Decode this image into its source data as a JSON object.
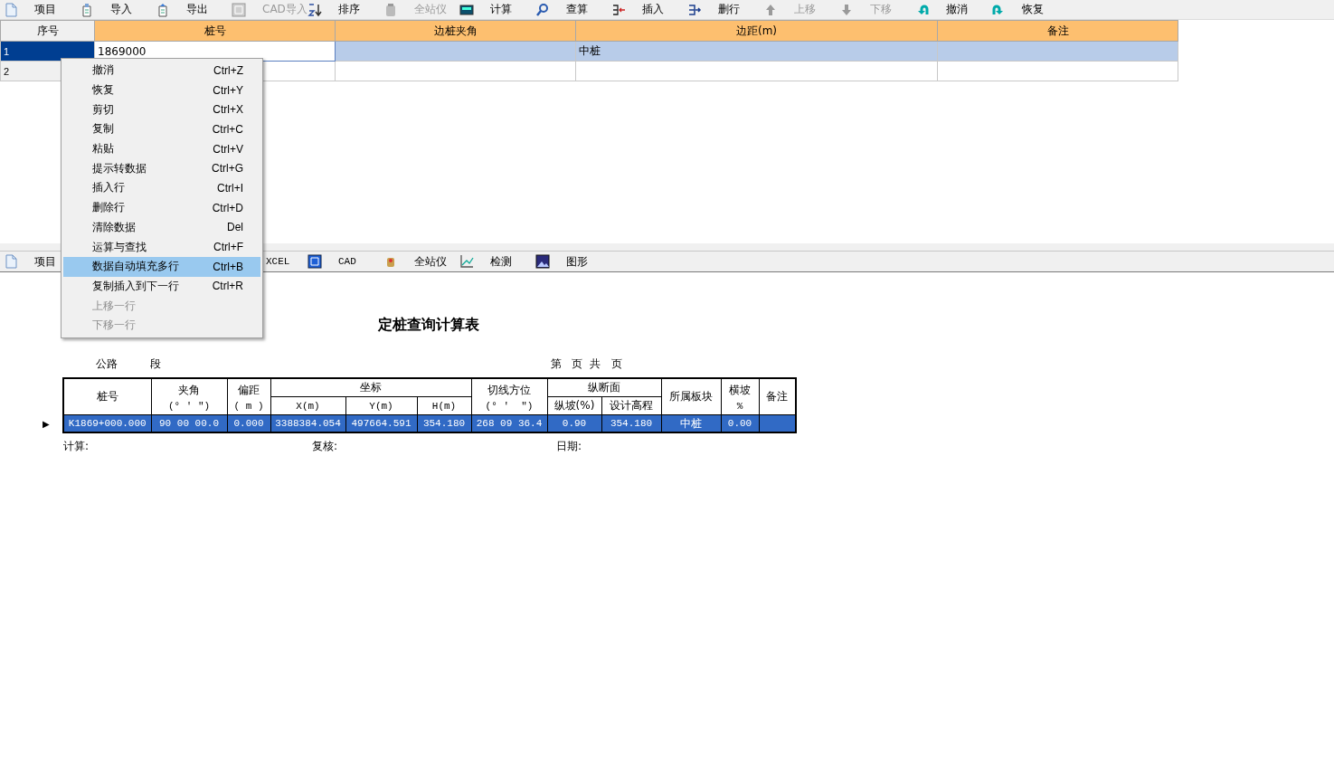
{
  "toolbar": {
    "items": [
      {
        "label": "项目",
        "disabled": false
      },
      {
        "label": "导入",
        "disabled": false
      },
      {
        "label": "导出",
        "disabled": false
      },
      {
        "label": "CAD导入",
        "disabled": true
      },
      {
        "label": "排序",
        "disabled": false
      },
      {
        "label": "全站仪",
        "disabled": true
      },
      {
        "label": "计算",
        "disabled": false
      },
      {
        "label": "查算",
        "disabled": false
      },
      {
        "label": "插入",
        "disabled": false
      },
      {
        "label": "删行",
        "disabled": false
      },
      {
        "label": "上移",
        "disabled": true
      },
      {
        "label": "下移",
        "disabled": true
      },
      {
        "label": "撤消",
        "disabled": false
      },
      {
        "label": "恢复",
        "disabled": false
      }
    ]
  },
  "grid": {
    "columns": [
      "序号",
      "桩号",
      "边桩夹角",
      "边距(m)",
      "备注"
    ],
    "rows": [
      {
        "selected": true,
        "cells": [
          "1",
          "1869000",
          "",
          "中桩",
          ""
        ]
      },
      {
        "selected": false,
        "cells": [
          "2",
          "",
          "",
          "",
          ""
        ]
      }
    ]
  },
  "report_toolbar": {
    "items": [
      {
        "label": "项目"
      },
      {
        "label": "XCEL"
      },
      {
        "label": "CAD"
      },
      {
        "label": "全站仪"
      },
      {
        "label": "检测"
      },
      {
        "label": "图形"
      }
    ]
  },
  "report": {
    "title": "定桩查询计算表",
    "road_label": "公路",
    "section_label": "段",
    "page_label": "第   页  共   页",
    "columns": [
      {
        "label": "桩号",
        "grouped": false
      },
      {
        "label": "夹角",
        "unit": "(° ′ ″)",
        "grouped": false
      },
      {
        "label": "偏距",
        "unit": "( m )",
        "grouped": false
      },
      {
        "label": "X(m)",
        "grouped": true
      },
      {
        "label": "Y(m)",
        "grouped": true
      },
      {
        "label": "H(m)",
        "grouped": true
      },
      {
        "label": "切线方位",
        "unit": "(° ′  ″)",
        "grouped": false
      },
      {
        "label": "纵坡(%)",
        "grouped": true
      },
      {
        "label": "设计高程",
        "grouped": true
      },
      {
        "label": "所属板块",
        "grouped": false
      },
      {
        "label": "横坡",
        "unit": "%",
        "grouped": false
      },
      {
        "label": "备注",
        "grouped": false
      }
    ],
    "column_groups": [
      "坐标",
      "纵断面"
    ],
    "rows": [
      {
        "selected": true,
        "marker": "▶",
        "cells": [
          "K1869+000.000",
          "90 00 00.0",
          "0.000",
          "3388384.054",
          "497664.591",
          "354.180",
          "268 09 36.4",
          "0.90",
          "354.180",
          "中桩",
          "0.00",
          ""
        ]
      }
    ],
    "footer": [
      "计算:",
      "复核:",
      "日期:"
    ]
  },
  "context_menu": {
    "items": [
      {
        "label": "撤消",
        "shortcut": "Ctrl+Z",
        "disabled": false,
        "selected": false
      },
      {
        "label": "恢复",
        "shortcut": "Ctrl+Y",
        "disabled": false,
        "selected": false
      },
      {
        "label": "剪切",
        "shortcut": "Ctrl+X",
        "disabled": false,
        "selected": false
      },
      {
        "label": "复制",
        "shortcut": "Ctrl+C",
        "disabled": false,
        "selected": false
      },
      {
        "label": "粘贴",
        "shortcut": "Ctrl+V",
        "disabled": false,
        "selected": false
      },
      {
        "label": "提示转数据",
        "shortcut": "Ctrl+G",
        "disabled": false,
        "selected": false
      },
      {
        "label": "插入行",
        "shortcut": "Ctrl+I",
        "disabled": false,
        "selected": false
      },
      {
        "label": "删除行",
        "shortcut": "Ctrl+D",
        "disabled": false,
        "selected": false
      },
      {
        "label": "清除数据",
        "shortcut": "Del",
        "disabled": false,
        "selected": false
      },
      {
        "label": "运算与查找",
        "shortcut": "Ctrl+F",
        "disabled": false,
        "selected": false
      },
      {
        "label": "数据自动填充多行",
        "shortcut": "Ctrl+B",
        "disabled": false,
        "selected": true
      },
      {
        "label": "复制插入到下一行",
        "shortcut": "Ctrl+R",
        "disabled": false,
        "selected": false
      },
      {
        "label": "上移一行",
        "disabled": true,
        "selected": false
      },
      {
        "label": "下移一行",
        "disabled": true,
        "selected": false
      }
    ]
  }
}
